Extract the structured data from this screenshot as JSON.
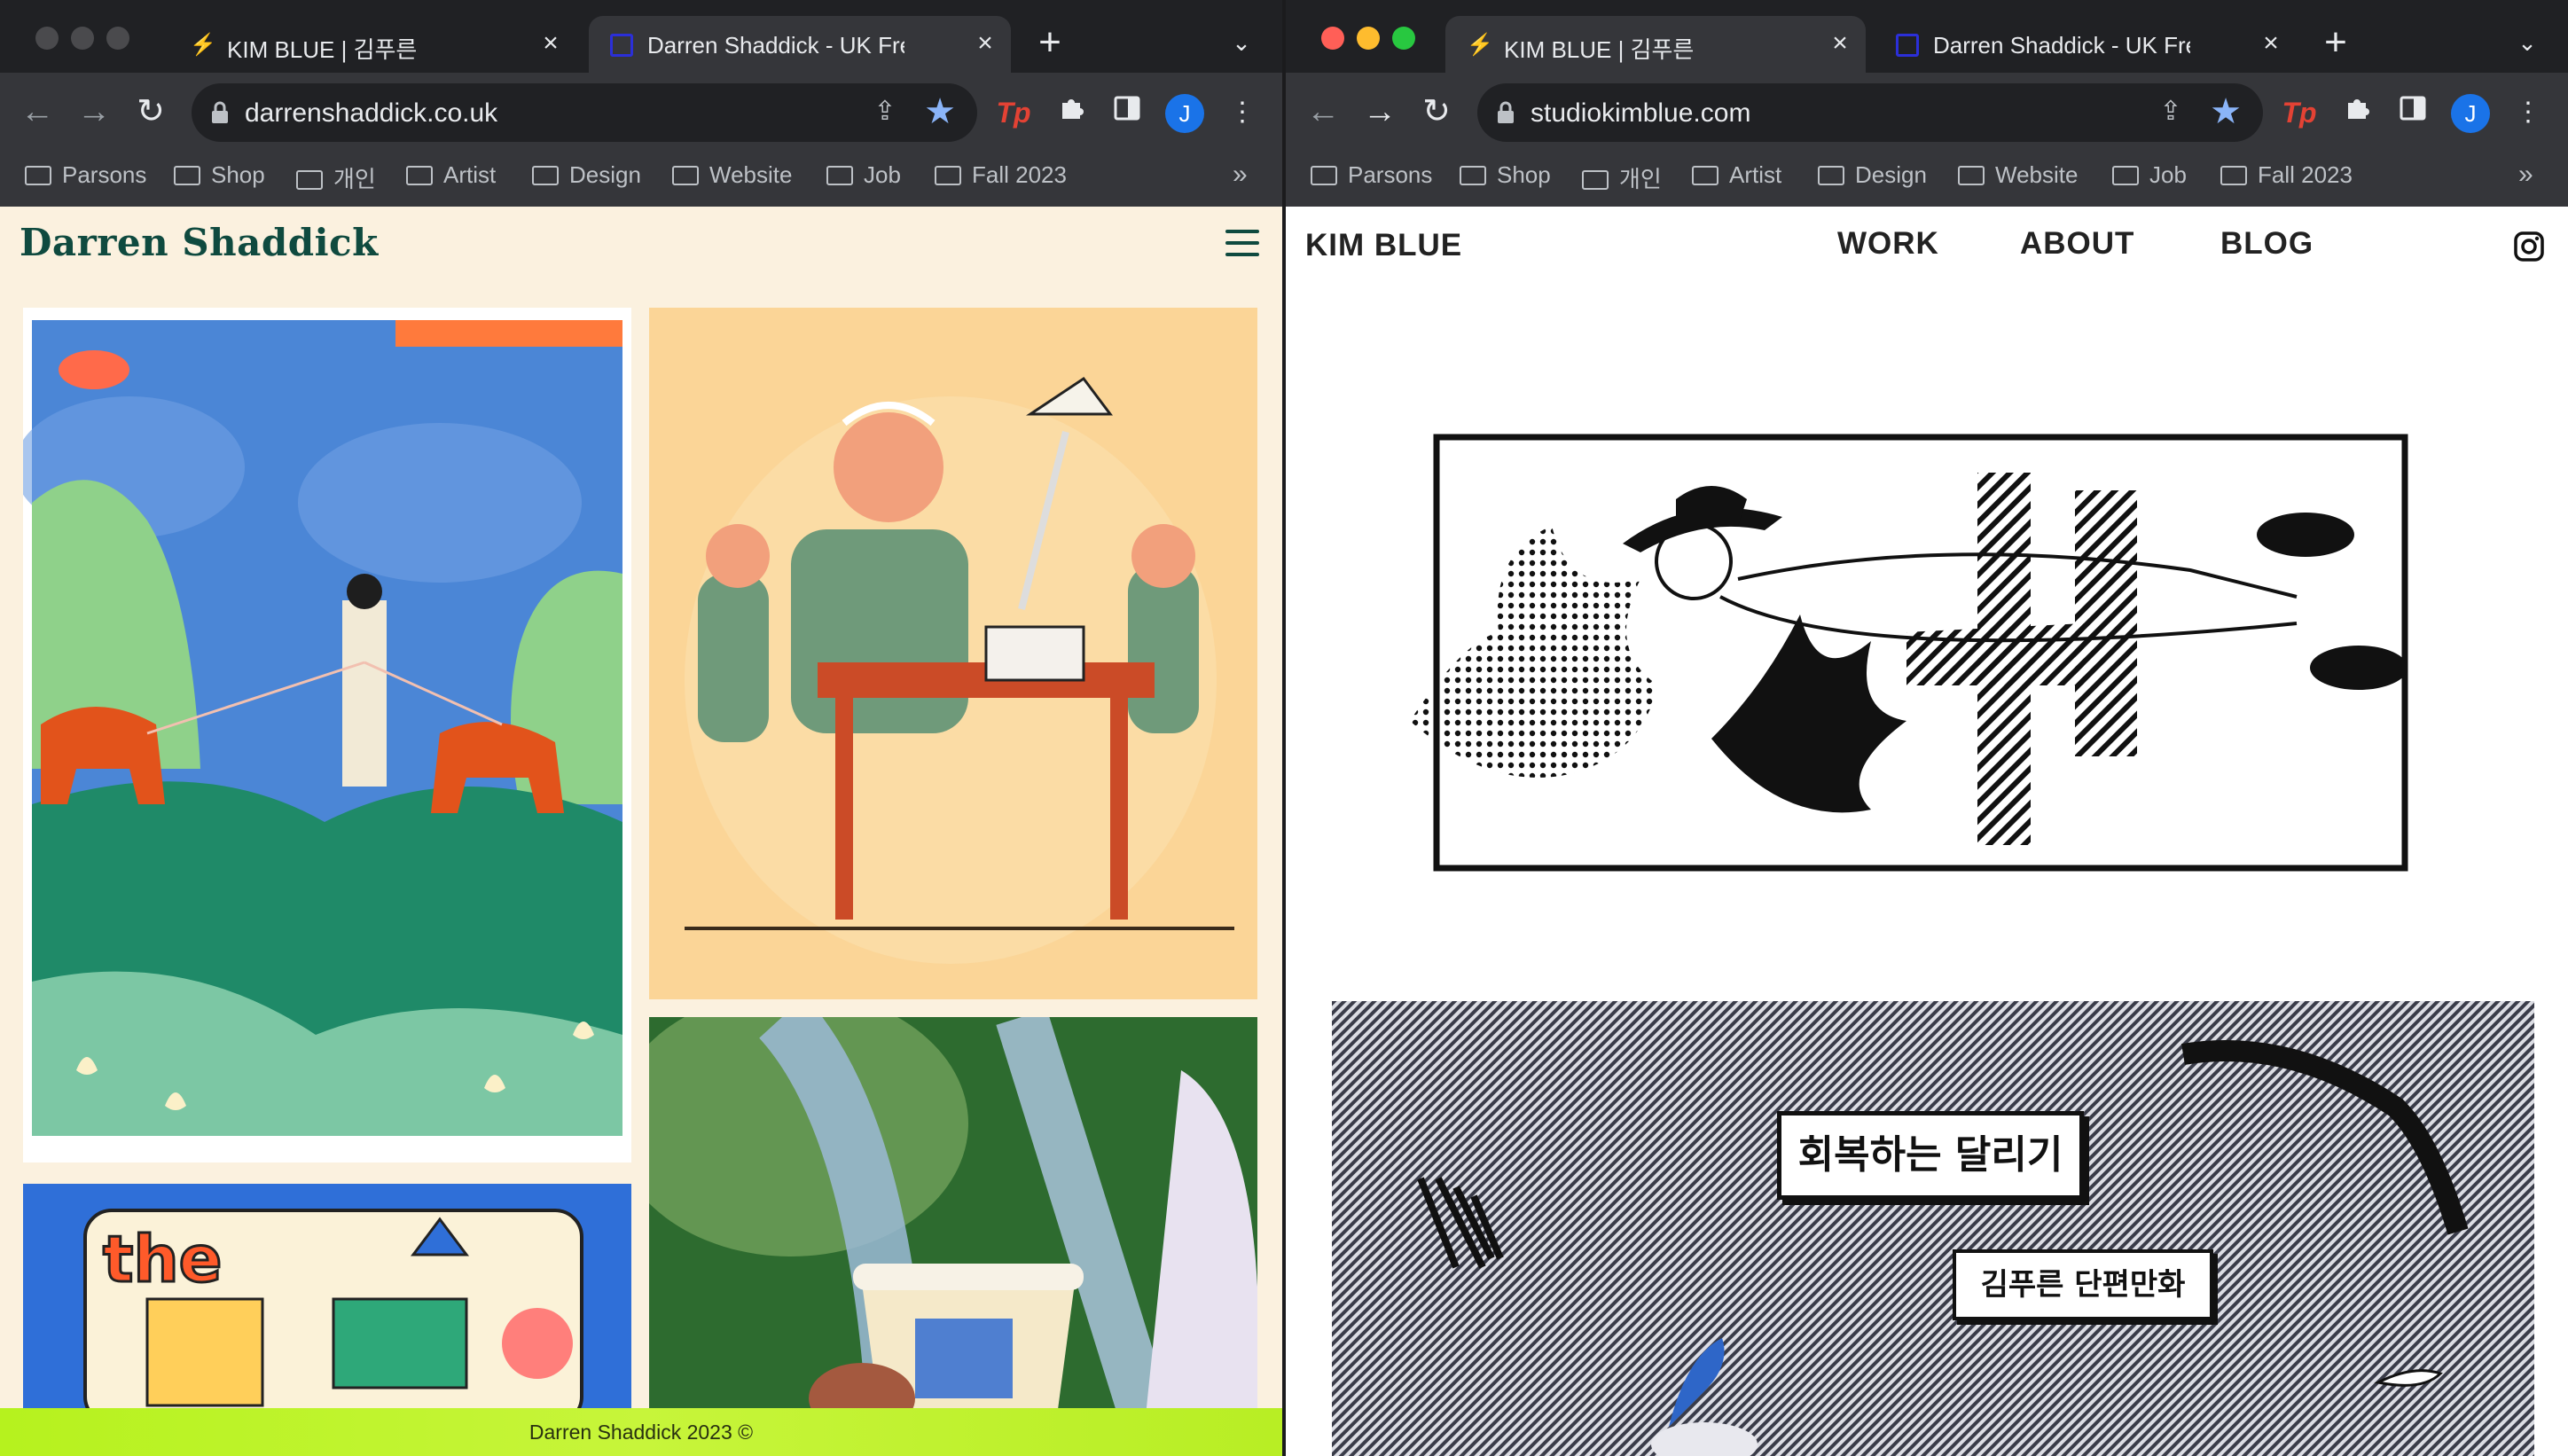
{
  "left_window": {
    "tabs": [
      {
        "title": "KIM BLUE | 김푸른",
        "favicon": "bolt-icon",
        "active": false
      },
      {
        "title": "Darren Shaddick - UK Freelance",
        "favicon": "square-frame-icon",
        "active": true
      }
    ],
    "url": "darrenshaddick.co.uk",
    "avatar_initial": "J",
    "bookmarks": [
      "Parsons",
      "Shop",
      "개인",
      "Artist",
      "Design",
      "Website",
      "Job",
      "Fall 2023"
    ],
    "bookmarks_more": "»",
    "site": {
      "logo": "Darren Shaddick",
      "footer": "Darren Shaddick 2023 ©"
    }
  },
  "right_window": {
    "tabs": [
      {
        "title": "KIM BLUE | 김푸른",
        "favicon": "bolt-icon",
        "active": true
      },
      {
        "title": "Darren Shaddick - UK Freelance",
        "favicon": "square-frame-icon",
        "active": false
      }
    ],
    "url": "studiokimblue.com",
    "avatar_initial": "J",
    "bookmarks": [
      "Parsons",
      "Shop",
      "개인",
      "Artist",
      "Design",
      "Website",
      "Job",
      "Fall 2023"
    ],
    "bookmarks_more": "»",
    "site": {
      "logo": "KIM BLUE",
      "nav": [
        "WORK",
        "ABOUT",
        "BLOG"
      ],
      "comic_title": "회복하는 달리기",
      "comic_subtitle": "김푸른 단편만화"
    }
  },
  "colors": {
    "chrome_bg": "#35363a",
    "tabstrip_bg": "#202124",
    "ds_background": "#fbf1df",
    "ds_green": "#0f4a3f",
    "ds_footer": "#c0f22e",
    "star": "#8ab4f8",
    "avatar": "#1a73e8"
  }
}
